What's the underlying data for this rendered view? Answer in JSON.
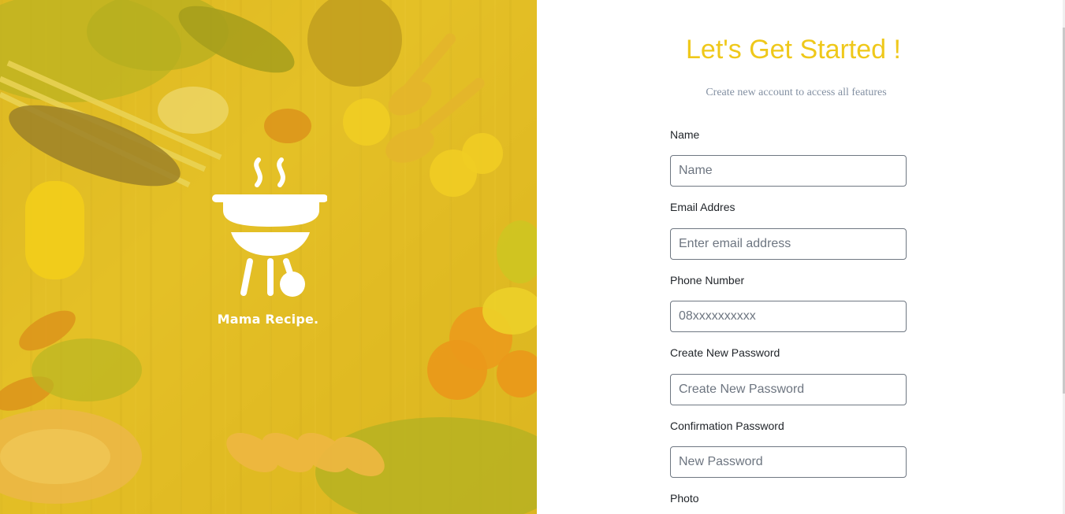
{
  "brand": {
    "name": "Mama Recipe.",
    "logo_icon": "grill-icon",
    "overlay_color": "#EFC81A"
  },
  "signup": {
    "title": "Let's Get Started !",
    "subtitle": "Create new account to access all features",
    "fields": [
      {
        "label": "Name",
        "placeholder": "Name",
        "type": "text"
      },
      {
        "label": "Email Addres",
        "placeholder": "Enter email address",
        "type": "email"
      },
      {
        "label": "Phone Number",
        "placeholder": "08xxxxxxxxxx",
        "type": "tel"
      },
      {
        "label": "Create New Password",
        "placeholder": "Create New Password",
        "type": "password"
      },
      {
        "label": "Confirmation Password",
        "placeholder": "New Password",
        "type": "password"
      },
      {
        "label": "Photo"
      }
    ]
  },
  "colors": {
    "accent": "#EFC81A",
    "subtitle": "#8390A2",
    "input_border": "#6F7782"
  }
}
